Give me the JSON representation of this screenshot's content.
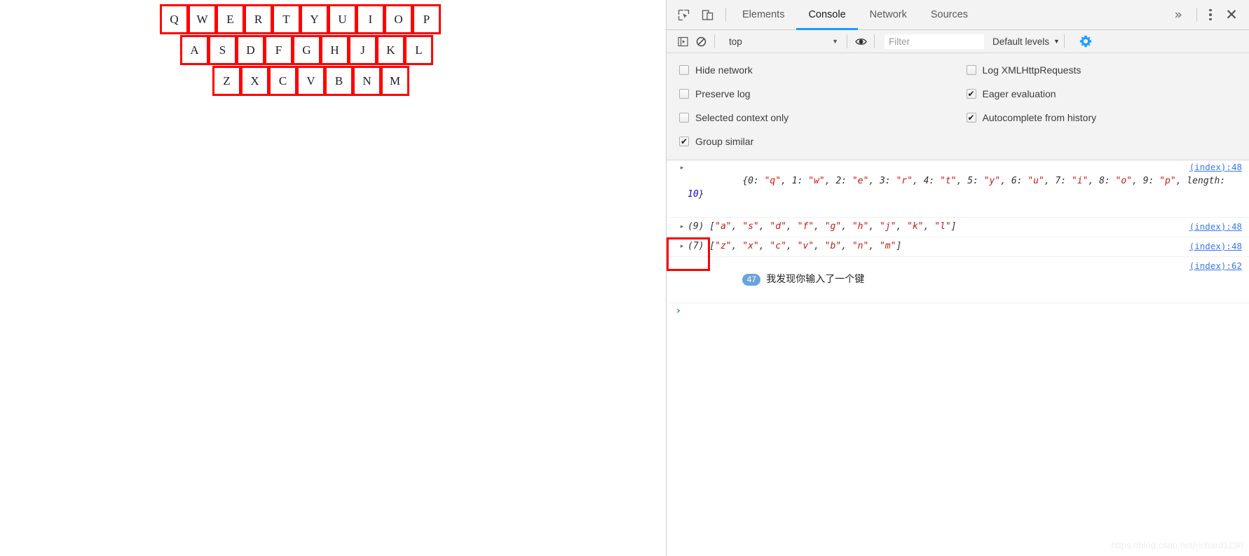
{
  "keyboard": {
    "rows": [
      {
        "name": "row-q",
        "keys": [
          "Q",
          "W",
          "E",
          "R",
          "T",
          "Y",
          "U",
          "I",
          "O",
          "P"
        ]
      },
      {
        "name": "row-a",
        "keys": [
          "A",
          "S",
          "D",
          "F",
          "G",
          "H",
          "J",
          "K",
          "L"
        ]
      },
      {
        "name": "row-z",
        "keys": [
          "Z",
          "X",
          "C",
          "V",
          "B",
          "N",
          "M"
        ]
      }
    ]
  },
  "devtools": {
    "tabs": [
      {
        "label": "Elements",
        "active": false
      },
      {
        "label": "Console",
        "active": true
      },
      {
        "label": "Network",
        "active": false
      },
      {
        "label": "Sources",
        "active": false
      }
    ],
    "more_label": "»",
    "icons": {
      "inspect": "inspect-element-icon",
      "device": "device-toolbar-icon",
      "kebab": "more-options-icon",
      "close": "close-devtools-icon"
    },
    "console_toolbar": {
      "sidebar_toggle": "console-sidebar-icon",
      "clear": "clear-console-icon",
      "context_value": "top",
      "caret": "▼",
      "eye": "live-expression-icon",
      "filter_placeholder": "Filter",
      "filter_value": "",
      "levels_label": "Default levels",
      "gear": "settings-gear-icon"
    },
    "settings": {
      "left": [
        {
          "label": "Hide network",
          "checked": false
        },
        {
          "label": "Preserve log",
          "checked": false
        },
        {
          "label": "Selected context only",
          "checked": false
        },
        {
          "label": "Group similar",
          "checked": true
        }
      ],
      "right": [
        {
          "label": "Log XMLHttpRequests",
          "checked": false
        },
        {
          "label": "Eager evaluation",
          "checked": true
        },
        {
          "label": "Autocomplete from history",
          "checked": true
        }
      ]
    },
    "console_logs": [
      {
        "kind": "object",
        "arrow": "▸",
        "text": "{0: \"q\", 1: \"w\", 2: \"e\", 3: \"r\", 4: \"t\", 5: \"y\", 6: \"u\", 7: \"i\", 8: \"o\", 9: \"p\", length: 10}",
        "source": "(index):48"
      },
      {
        "kind": "array",
        "arrow": "▸",
        "text": "(9) [\"a\", \"s\", \"d\", \"f\", \"g\", \"h\", \"j\", \"k\", \"l\"]",
        "source": "(index):48"
      },
      {
        "kind": "array",
        "arrow": "▸",
        "text": "(7) [\"z\", \"x\", \"c\", \"v\", \"b\", \"n\", \"m\"]",
        "source": "(index):48"
      },
      {
        "kind": "message",
        "badge": "47",
        "text": "我发现你输入了一个键",
        "source": "(index):62"
      }
    ],
    "prompt_caret": "›"
  },
  "watermark": "https://blog.csdn.net/richard1230",
  "colors": {
    "key_border": "#ff0000",
    "tab_active_underline": "#1a9dfc",
    "gear": "#1a9dfc",
    "string_literal": "#c41a16",
    "number_literal": "#1c00cf",
    "source_link": "#3b78e7",
    "badge": "#6ba2e0",
    "annotation": "#ff0000"
  }
}
